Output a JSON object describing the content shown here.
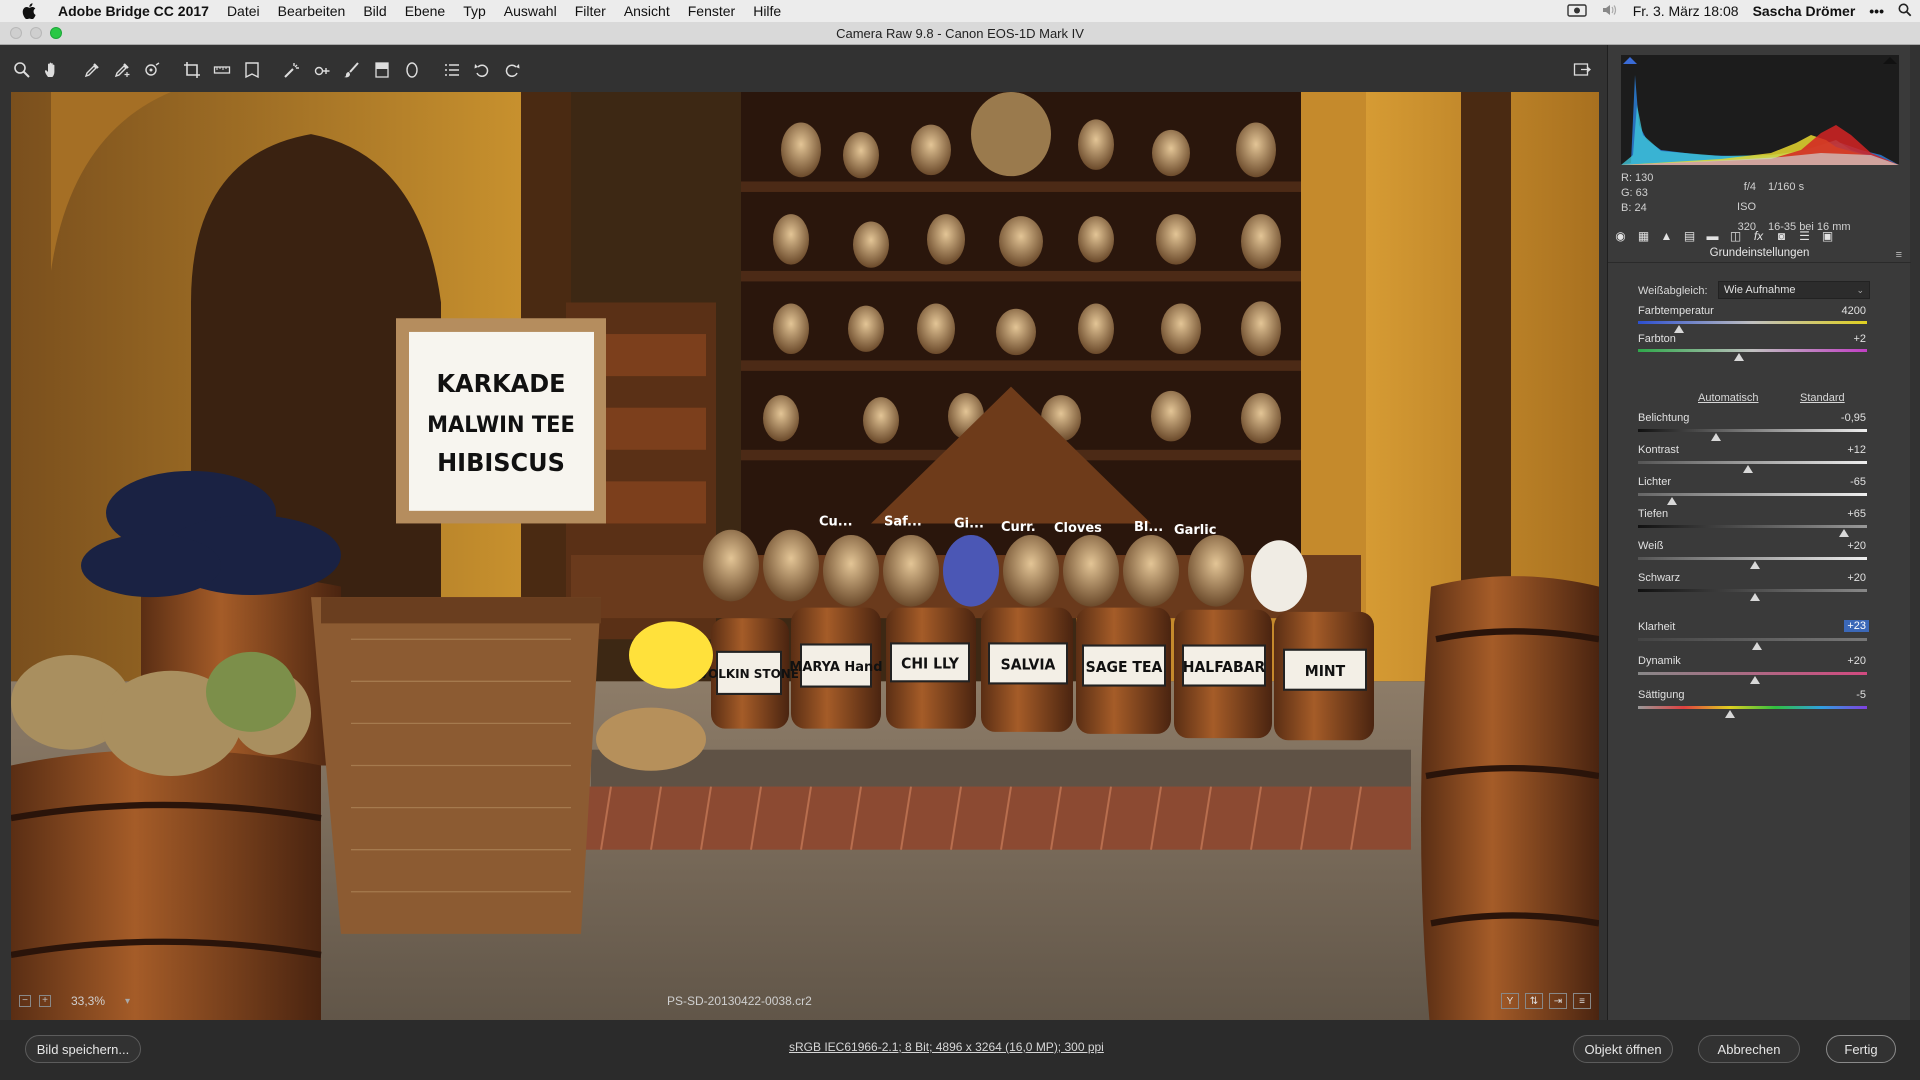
{
  "menubar": {
    "app": "Adobe Bridge CC 2017",
    "items": [
      "Datei",
      "Bearbeiten",
      "Bild",
      "Ebene",
      "Typ",
      "Auswahl",
      "Filter",
      "Ansicht",
      "Fenster",
      "Hilfe"
    ],
    "clock": "Fr. 3. März  18:08",
    "user": "Sascha Drömer"
  },
  "window": {
    "title": "Camera Raw 9.8  -  Canon EOS-1D Mark IV"
  },
  "toolbar": {
    "tools": [
      "zoom-tool",
      "hand-tool",
      "white-balance-tool",
      "color-sampler-tool",
      "targeted-adjustment-tool",
      "crop-tool",
      "straighten-tool",
      "transform-tool",
      "spot-removal-tool",
      "red-eye-tool",
      "adjustment-brush",
      "graduated-filter",
      "radial-filter",
      "preferences",
      "rotate-left",
      "rotate-right"
    ]
  },
  "photo": {
    "signs": {
      "main": [
        "KARKADE",
        "MALWIN TEE",
        "HIBISCUS"
      ],
      "barrels": [
        "VOLKIN STONE",
        "MARYA Hand",
        "CHI LLY",
        "SALVIA",
        "SAGE TEA",
        "HALFABAR",
        "MINT"
      ],
      "jars": [
        "Cu...",
        "Saf...",
        "Gi...",
        "Curr.",
        "Cloves",
        "Bl...",
        "Garlic"
      ]
    }
  },
  "status": {
    "zoom": "33,3%",
    "filename": "PS-SD-20130422-0038.cr2"
  },
  "readout": {
    "r": "R:  130",
    "g": "G:   63",
    "b": "B:   24",
    "aperture": "f/4",
    "shutter": "1/160 s",
    "iso": "ISO 320",
    "lens": "16-35 bei 16 mm"
  },
  "panel": {
    "title": "Grundeinstellungen",
    "wb_label": "Weißabgleich:",
    "wb_value": "Wie Aufnahme",
    "auto": "Automatisch",
    "standard": "Standard",
    "sliders": [
      {
        "label": "Farbtemperatur",
        "value": "4200",
        "pos": 0.18
      },
      {
        "label": "Farbton",
        "value": "+2",
        "pos": 0.44
      },
      {
        "label": "Belichtung",
        "value": "-0,95",
        "pos": 0.34
      },
      {
        "label": "Kontrast",
        "value": "+12",
        "pos": 0.48
      },
      {
        "label": "Lichter",
        "value": "-65",
        "pos": 0.15
      },
      {
        "label": "Tiefen",
        "value": "+65",
        "pos": 0.9
      },
      {
        "label": "Weiß",
        "value": "+20",
        "pos": 0.51
      },
      {
        "label": "Schwarz",
        "value": "+20",
        "pos": 0.51
      },
      {
        "label": "Klarheit",
        "value": "+23",
        "pos": 0.52
      },
      {
        "label": "Dynamik",
        "value": "+20",
        "pos": 0.51
      },
      {
        "label": "Sättigung",
        "value": "-5",
        "pos": 0.4
      }
    ]
  },
  "bottom": {
    "save": "Bild speichern...",
    "info": "sRGB IEC61966-2.1; 8 Bit; 4896 x 3264 (16,0 MP); 300 ppi",
    "open": "Objekt öffnen",
    "cancel": "Abbrechen",
    "done": "Fertig"
  }
}
